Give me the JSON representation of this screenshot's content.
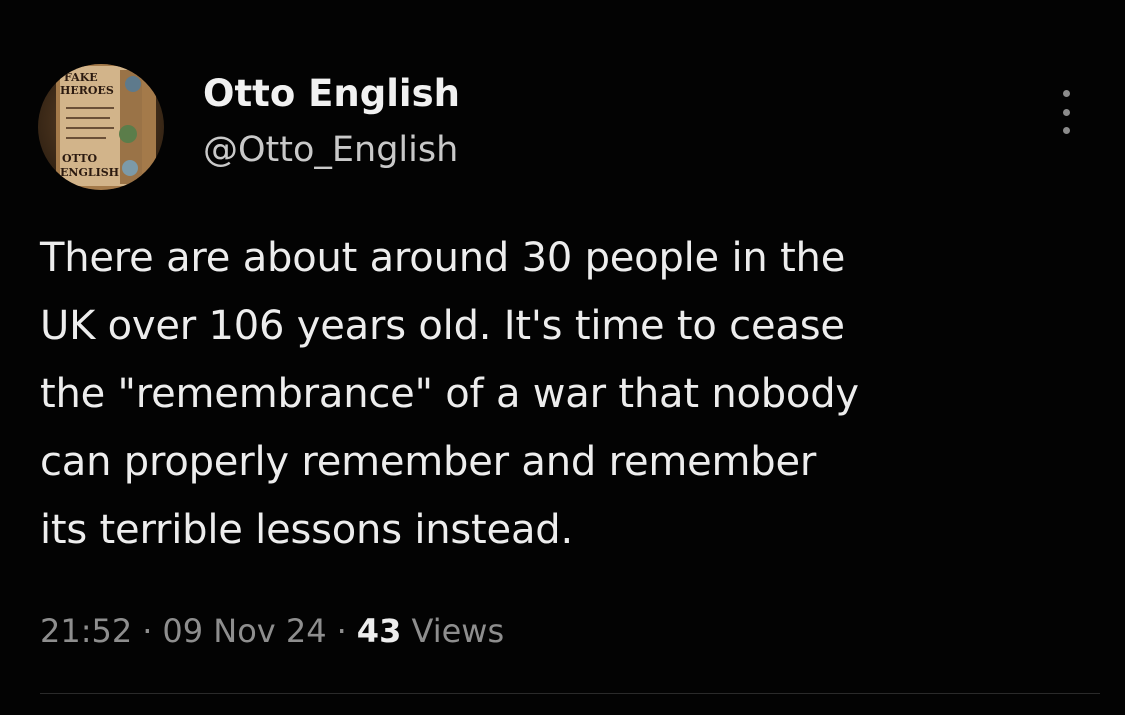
{
  "author": {
    "name": "Otto English",
    "handle": "@Otto_English"
  },
  "avatar": {
    "book_title": "FAKE HEROES",
    "book_author": "OTTO ENGLISH",
    "colors": {
      "frame": "#c9a878",
      "cover_text": "#2b1a10"
    }
  },
  "tweet": {
    "text_lines": [
      "There are about around 30 people in the",
      "UK over 106 years old. It's time to cease",
      "the \"remembrance\" of a war that nobody",
      "can properly remember and remember",
      "its terrible lessons instead."
    ],
    "time": "21:52",
    "date": "09 Nov 24",
    "separator": "·",
    "views_count": "43",
    "views_label": "Views"
  },
  "icons": {
    "more": "more-horizontal-dots-icon"
  },
  "colors": {
    "background": "#030303",
    "text_primary": "#ededed",
    "text_secondary": "#8e8e8e"
  }
}
